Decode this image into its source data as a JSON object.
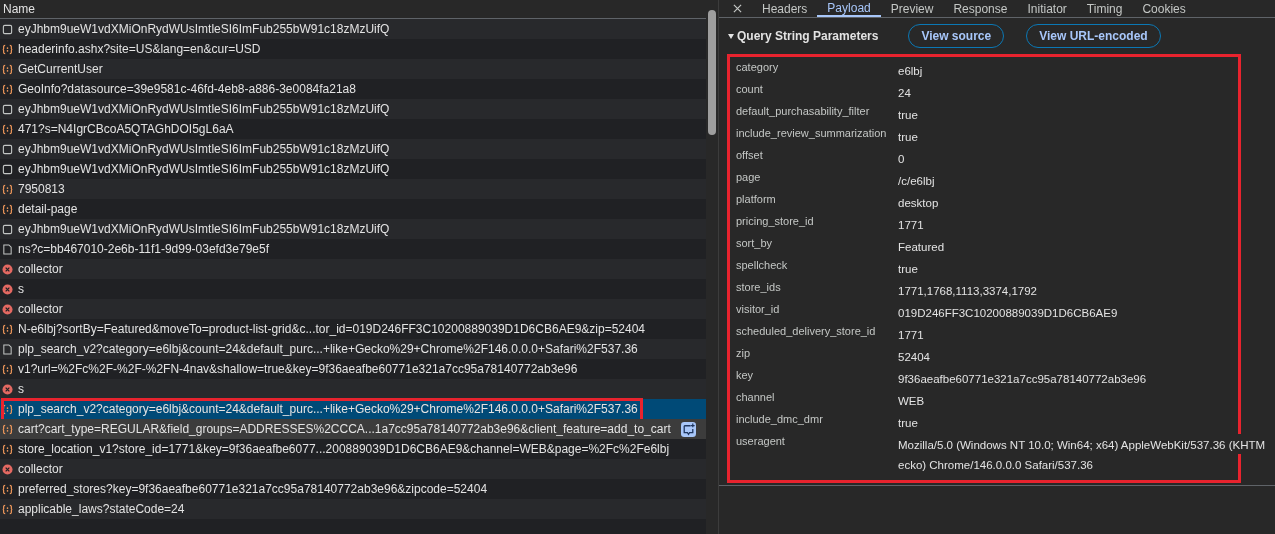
{
  "requests": {
    "column": "Name",
    "rows": [
      {
        "kind": "doc",
        "name": "eyJhbm9ueW1vdXMiOnRydWUsImtleSI6ImFub255bW91c18zMzUifQ",
        "selected": false,
        "hovered": false,
        "highlighted": false
      },
      {
        "kind": "xhr",
        "name": "headerinfo.ashx?site=US&lang=en&cur=USD",
        "selected": false,
        "hovered": false,
        "highlighted": false
      },
      {
        "kind": "xhr",
        "name": "GetCurrentUser",
        "selected": false,
        "hovered": false,
        "highlighted": false
      },
      {
        "kind": "xhr",
        "name": "GeoInfo?datasource=39e9581c-46fd-4eb8-a886-3e0084fa21a8",
        "selected": false,
        "hovered": false,
        "highlighted": false
      },
      {
        "kind": "doc",
        "name": "eyJhbm9ueW1vdXMiOnRydWUsImtleSI6ImFub255bW91c18zMzUifQ",
        "selected": false,
        "hovered": false,
        "highlighted": false
      },
      {
        "kind": "xhr",
        "name": "471?s=N4IgrCBcoA5QTAGhDOI5gL6aA",
        "selected": false,
        "hovered": false,
        "highlighted": false
      },
      {
        "kind": "doc",
        "name": "eyJhbm9ueW1vdXMiOnRydWUsImtleSI6ImFub255bW91c18zMzUifQ",
        "selected": false,
        "hovered": false,
        "highlighted": false
      },
      {
        "kind": "doc",
        "name": "eyJhbm9ueW1vdXMiOnRydWUsImtleSI6ImFub255bW91c18zMzUifQ",
        "selected": false,
        "hovered": false,
        "highlighted": false
      },
      {
        "kind": "xhr",
        "name": "7950813",
        "selected": false,
        "hovered": false,
        "highlighted": false
      },
      {
        "kind": "xhr",
        "name": "detail-page",
        "selected": false,
        "hovered": false,
        "highlighted": false
      },
      {
        "kind": "doc",
        "name": "eyJhbm9ueW1vdXMiOnRydWUsImtleSI6ImFub255bW91c18zMzUifQ",
        "selected": false,
        "hovered": false,
        "highlighted": false
      },
      {
        "kind": "page",
        "name": "ns?c=bb467010-2e6b-11f1-9d99-03efd3e79e5f",
        "selected": false,
        "hovered": false,
        "highlighted": false
      },
      {
        "kind": "error",
        "name": "collector",
        "selected": false,
        "hovered": false,
        "highlighted": false
      },
      {
        "kind": "error",
        "name": "s",
        "selected": false,
        "hovered": false,
        "highlighted": false
      },
      {
        "kind": "error",
        "name": "collector",
        "selected": false,
        "hovered": false,
        "highlighted": false
      },
      {
        "kind": "xhr",
        "name": "N-e6lbj?sortBy=Featured&moveTo=product-list-grid&c...tor_id=019D246FF3C10200889039D1D6CB6AE9&zip=52404",
        "selected": false,
        "hovered": false,
        "highlighted": false
      },
      {
        "kind": "page",
        "name": "plp_search_v2?category=e6lbj&count=24&default_purc...+like+Gecko%29+Chrome%2F146.0.0.0+Safari%2F537.36",
        "selected": false,
        "hovered": false,
        "highlighted": false
      },
      {
        "kind": "xhr",
        "name": "v1?url=%2Fc%2F-%2F-%2FN-4nav&shallow=true&key=9f36aeafbe60771e321a7cc95a78140772ab3e96",
        "selected": false,
        "hovered": false,
        "highlighted": false
      },
      {
        "kind": "error",
        "name": "s",
        "selected": false,
        "hovered": false,
        "highlighted": false
      },
      {
        "kind": "xhr",
        "name": "plp_search_v2?category=e6lbj&count=24&default_purc...+like+Gecko%29+Chrome%2F146.0.0.0+Safari%2F537.36",
        "selected": true,
        "hovered": false,
        "highlighted": true
      },
      {
        "kind": "xhr",
        "name": "cart?cart_type=REGULAR&field_groups=ADDRESSES%2CCCA...1a7cc95a78140772ab3e96&client_feature=add_to_cart",
        "selected": false,
        "hovered": true,
        "highlighted": false
      },
      {
        "kind": "xhr",
        "name": "store_location_v1?store_id=1771&key=9f36aeafbe6077...200889039D1D6CB6AE9&channel=WEB&page=%2Fc%2Fe6lbj",
        "selected": false,
        "hovered": false,
        "highlighted": false
      },
      {
        "kind": "error",
        "name": "collector",
        "selected": false,
        "hovered": false,
        "highlighted": false
      },
      {
        "kind": "xhr",
        "name": "preferred_stores?key=9f36aeafbe60771e321a7cc95a78140772ab3e96&zipcode=52404",
        "selected": false,
        "hovered": false,
        "highlighted": false
      },
      {
        "kind": "xhr",
        "name": "applicable_laws?stateCode=24",
        "selected": false,
        "hovered": false,
        "highlighted": false
      }
    ]
  },
  "details": {
    "tabs": [
      {
        "label": "Headers",
        "selected": false
      },
      {
        "label": "Payload",
        "selected": true
      },
      {
        "label": "Preview",
        "selected": false
      },
      {
        "label": "Response",
        "selected": false
      },
      {
        "label": "Initiator",
        "selected": false
      },
      {
        "label": "Timing",
        "selected": false
      },
      {
        "label": "Cookies",
        "selected": false
      }
    ],
    "section": {
      "title": "Query String Parameters",
      "expanded": true,
      "buttons": [
        "View source",
        "View URL-encoded"
      ],
      "highlighted": true,
      "params": [
        {
          "key": "category",
          "value": "e6lbj"
        },
        {
          "key": "count",
          "value": "24"
        },
        {
          "key": "default_purchasability_filter",
          "value": "true"
        },
        {
          "key": "include_review_summarization",
          "value": "true"
        },
        {
          "key": "offset",
          "value": "0"
        },
        {
          "key": "page",
          "value": "/c/e6lbj"
        },
        {
          "key": "platform",
          "value": "desktop"
        },
        {
          "key": "pricing_store_id",
          "value": "1771"
        },
        {
          "key": "sort_by",
          "value": "Featured"
        },
        {
          "key": "spellcheck",
          "value": "true"
        },
        {
          "key": "store_ids",
          "value": "1771,1768,1113,3374,1792"
        },
        {
          "key": "visitor_id",
          "value": "019D246FF3C10200889039D1D6CB6AE9"
        },
        {
          "key": "scheduled_delivery_store_id",
          "value": "1771"
        },
        {
          "key": "zip",
          "value": "52404"
        },
        {
          "key": "key",
          "value": "9f36aeafbe60771e321a7cc95a78140772ab3e96"
        },
        {
          "key": "channel",
          "value": "WEB"
        },
        {
          "key": "include_dmc_dmr",
          "value": "true"
        },
        {
          "key": "useragent",
          "value": "Mozilla/5.0 (Windows NT 10.0; Win64; x64) AppleWebKit/537.36 (KHTM",
          "continuation": "ecko) Chrome/146.0.0.0 Safari/537.36"
        }
      ]
    }
  }
}
